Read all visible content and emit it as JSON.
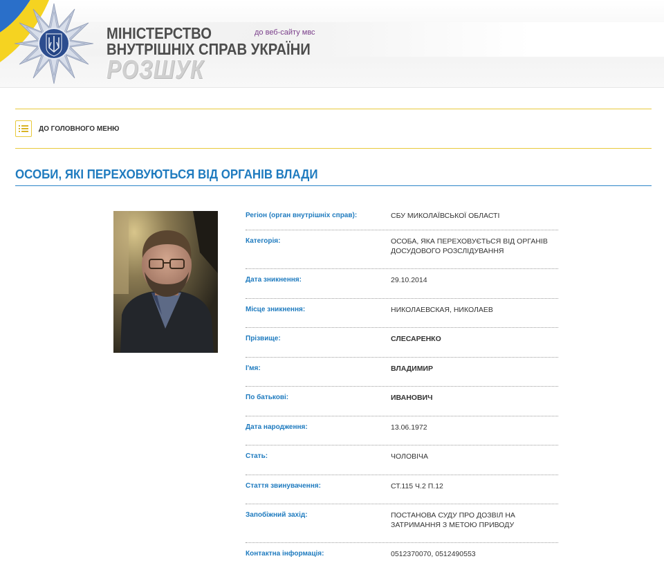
{
  "header": {
    "title_line1": "МІНІСТЕРСТВО",
    "title_line2": "ВНУТРІШНІХ СПРАВ УКРАЇНИ",
    "site_link": "до веб-сайту мвс",
    "section_logo": "РОЗШУК",
    "emblem_icon": "police-star-trident-icon",
    "flag_colors": [
      "#2a6fc9",
      "#f5d321"
    ]
  },
  "menu": {
    "label": "ДО ГОЛОВНОГО МЕНЮ",
    "icon": "list-icon",
    "accent_color": "#e8c93a"
  },
  "page_title": "ОСОБИ, ЯКІ ПЕРЕХОВУЮТЬСЯ ВІД ОРГАНІВ ВЛАДИ",
  "colors": {
    "label_blue": "#1f7bbf",
    "text": "#333333"
  },
  "details": [
    {
      "label": "Регіон (орган внутрішніх справ):",
      "value": "СБУ МИКОЛАЇВСЬКОЇ ОБЛАСТІ"
    },
    {
      "label": "Категорія:",
      "value": "ОСОБА, ЯКА ПЕРЕХОВУЄТЬСЯ ВІД ОРГАНІВ ДОСУДОВОГО РОЗСЛІДУВАННЯ"
    },
    {
      "label": "Дата зникнення:",
      "value": "29.10.2014"
    },
    {
      "label": "Місце зникнення:",
      "value": "НИКОЛАЕВСКАЯ, НИКОЛАЕВ"
    },
    {
      "label": "Прізвище:",
      "value": "СЛЕСАРЕНКО"
    },
    {
      "label": "І'мя:",
      "value": "ВЛАДИМИР"
    },
    {
      "label": "По батькові:",
      "value": "ИВАНОВИЧ"
    },
    {
      "label": "Дата народження:",
      "value": "13.06.1972"
    },
    {
      "label": "Стать:",
      "value": "ЧОЛОВІЧА"
    },
    {
      "label": "Стаття звинувачення:",
      "value": "СТ.115 Ч.2 П.12"
    },
    {
      "label": "Запобіжний захід:",
      "value": "ПОСТАНОВА СУДУ ПРО ДОЗВІЛ НА ЗАТРИМАННЯ З МЕТОЮ ПРИВОДУ"
    },
    {
      "label": "Контактна інформація:",
      "value": "0512370070, 0512490553"
    }
  ]
}
